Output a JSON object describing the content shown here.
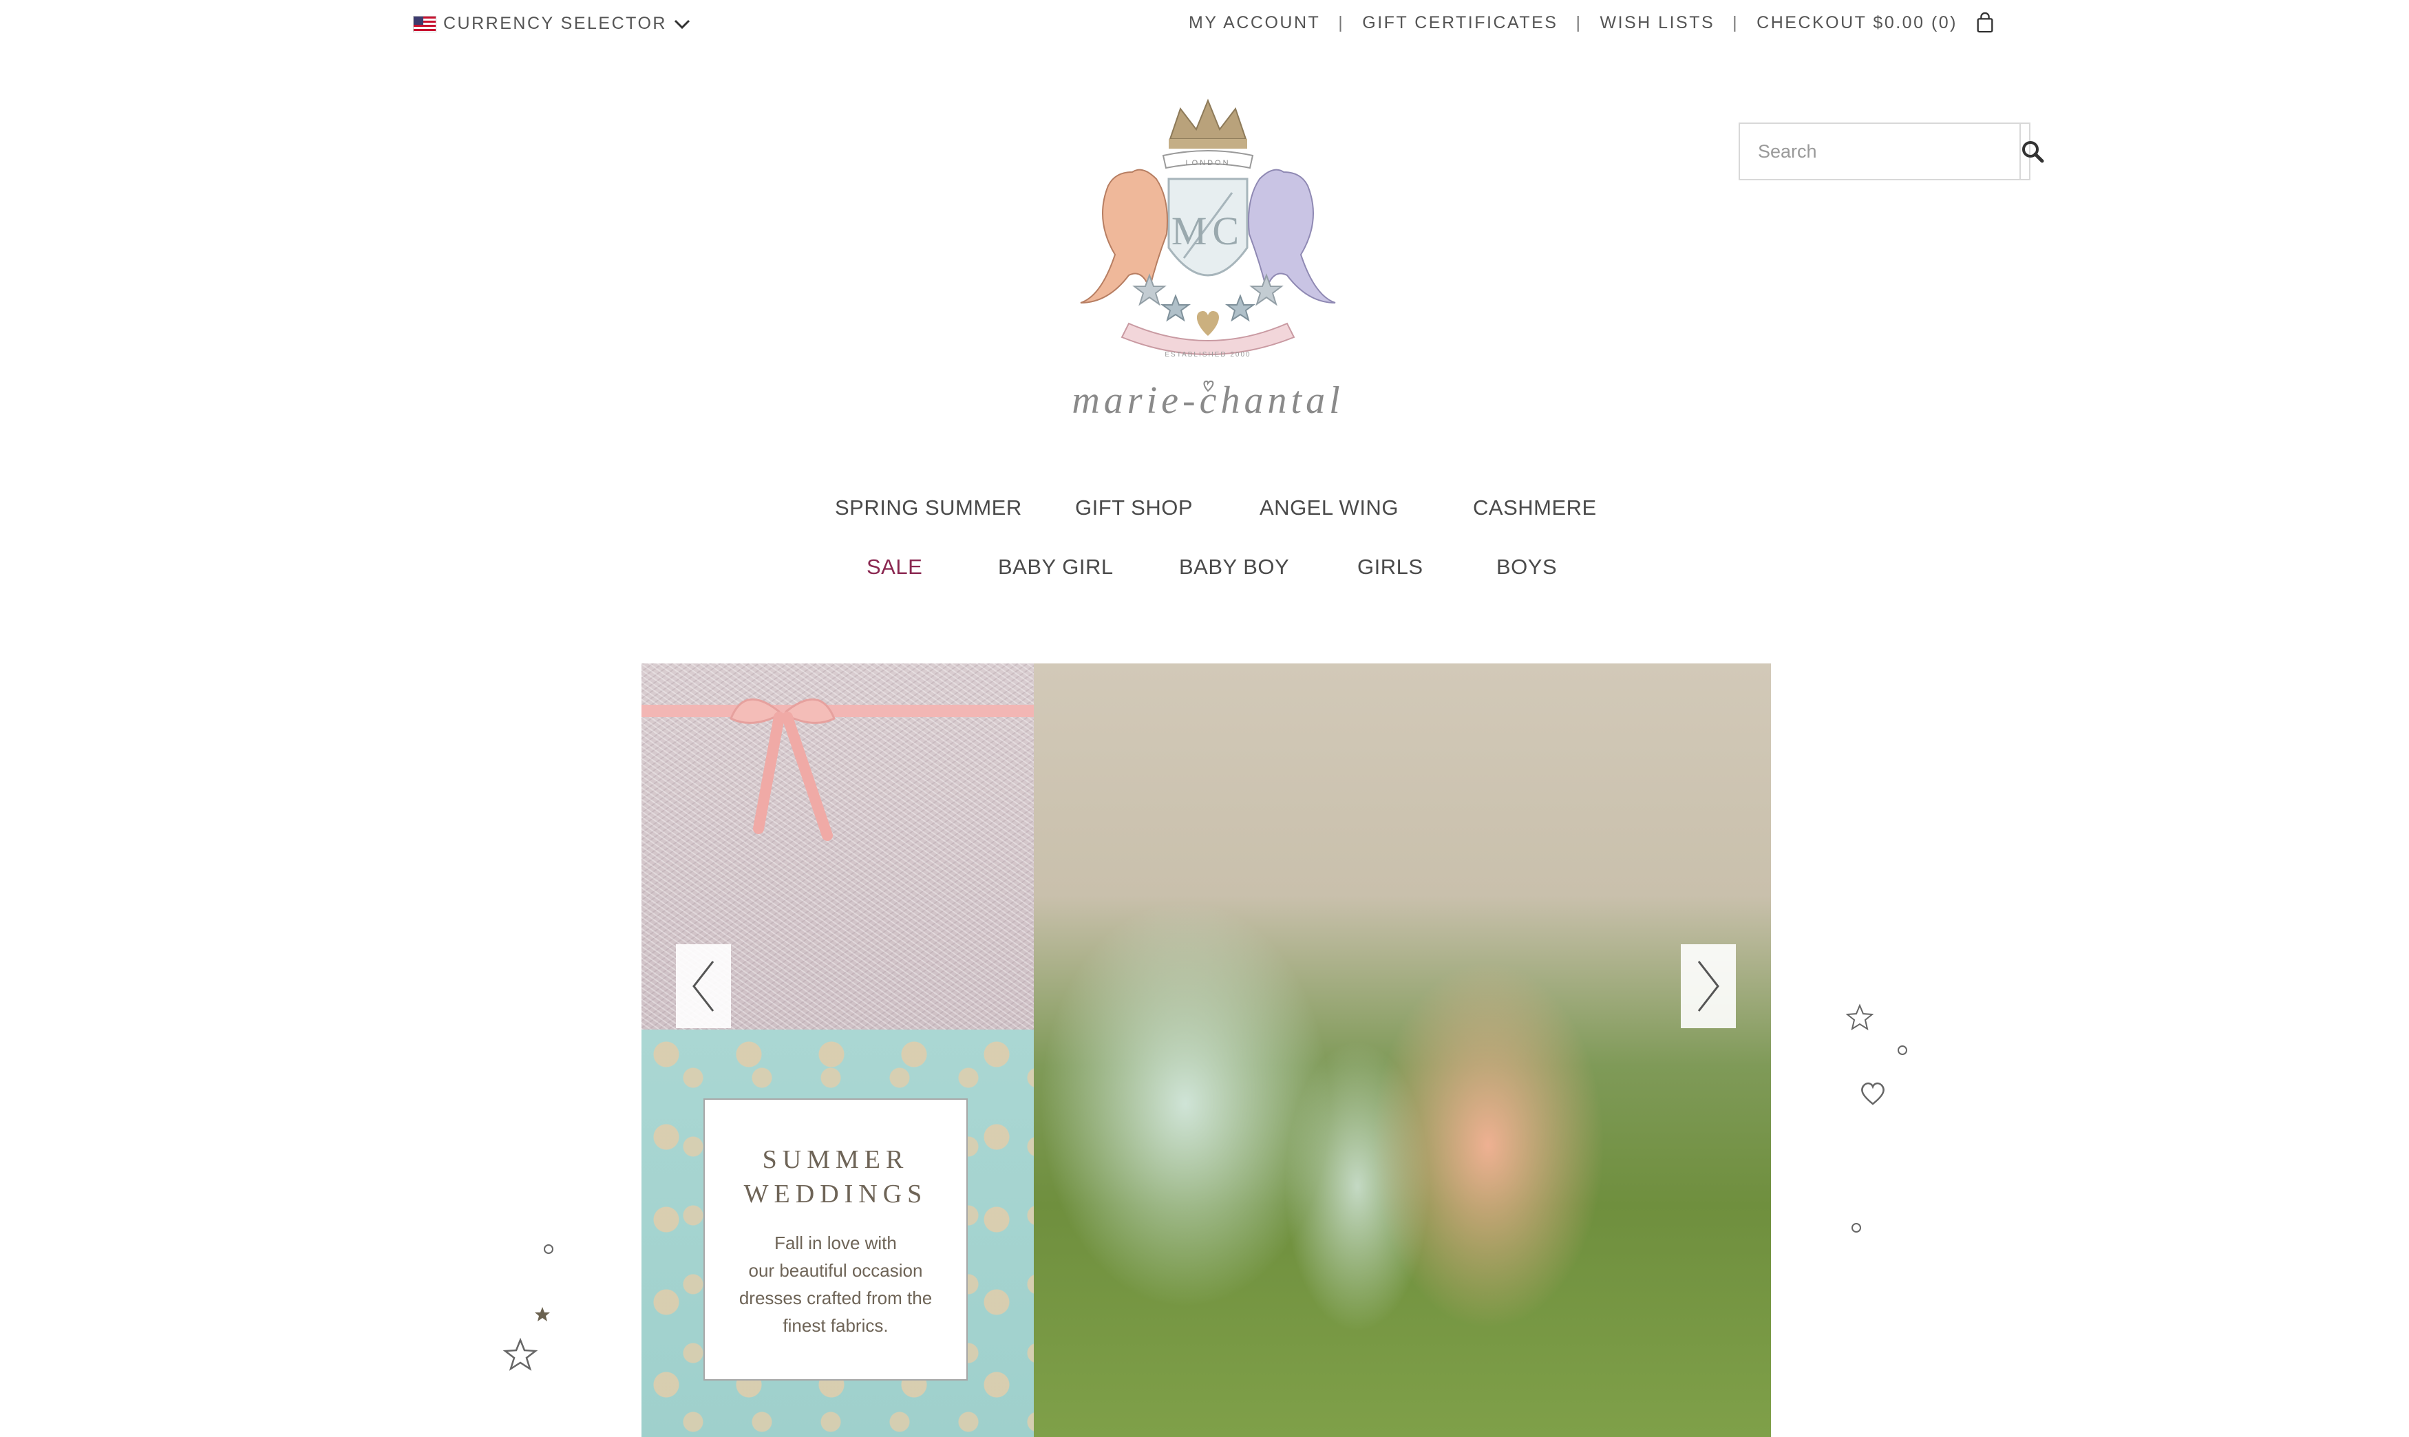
{
  "topbar": {
    "currency_label": "CURRENCY SELECTOR",
    "links": [
      "MY ACCOUNT",
      "GIFT CERTIFICATES",
      "WISH LISTS",
      "CHECKOUT $0.00 (0)"
    ],
    "separator": "|"
  },
  "search": {
    "placeholder": "Search"
  },
  "brand": {
    "top_banner": "LONDON",
    "monogram": "MC",
    "established": "ESTABLISHED 2000",
    "script_name": "marie-chantal"
  },
  "nav": {
    "row1": [
      "SPRING SUMMER",
      "GIFT SHOP",
      "ANGEL WING",
      "CASHMERE"
    ],
    "row2": [
      "SALE",
      "BABY GIRL",
      "BABY BOY",
      "GIRLS",
      "BOYS"
    ]
  },
  "hero": {
    "title_line1": "SUMMER",
    "title_line2": "WEDDINGS",
    "body_lines": [
      "Fall in love with",
      "our beautiful occasion",
      "dresses crafted from the",
      "finest fabrics."
    ]
  },
  "colors": {
    "sale": "#8a2750",
    "text": "#555555",
    "card_text": "#6e6457"
  },
  "icons": [
    "flag-us-icon",
    "chevron-down-icon",
    "shopping-bag-icon",
    "search-icon",
    "arrow-left-icon",
    "arrow-right-icon",
    "star-icon",
    "heart-icon",
    "circle-icon"
  ]
}
